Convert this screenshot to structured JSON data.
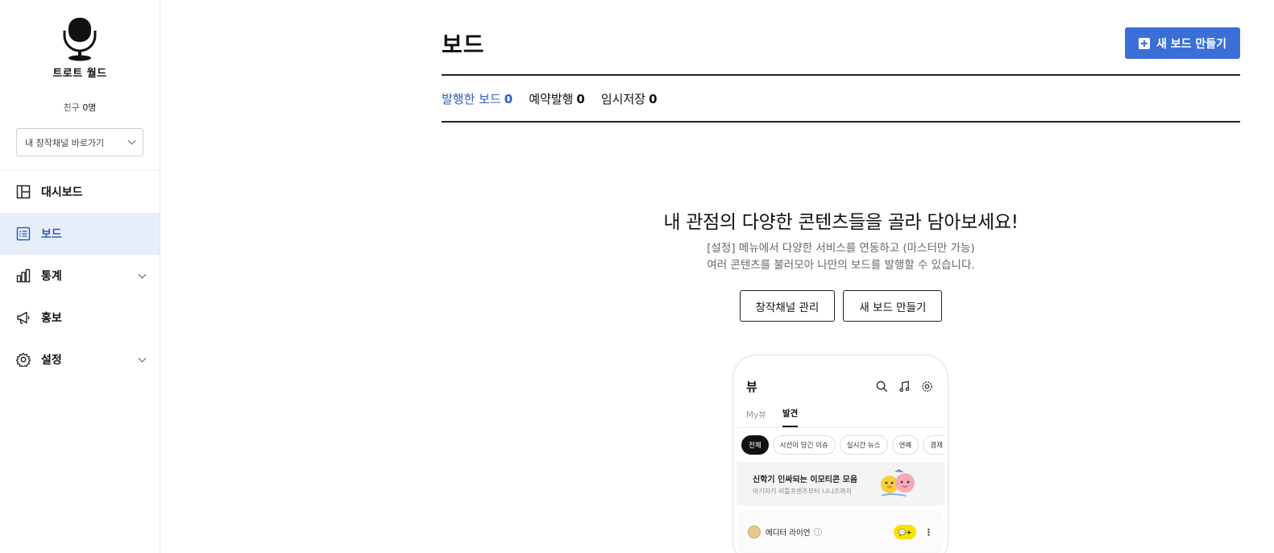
{
  "sidebar": {
    "channel_name": "트로트 월드",
    "friends_label": "친구",
    "friends_count": "0명",
    "channel_select": "내 창작채널 바로가기",
    "nav": [
      {
        "label": "대시보드",
        "icon": "dashboard-icon",
        "expandable": false,
        "active": false
      },
      {
        "label": "보드",
        "icon": "board-list-icon",
        "expandable": false,
        "active": true
      },
      {
        "label": "통계",
        "icon": "stats-chart-icon",
        "expandable": true,
        "active": false
      },
      {
        "label": "홍보",
        "icon": "megaphone-icon",
        "expandable": false,
        "active": false
      },
      {
        "label": "설정",
        "icon": "gear-icon",
        "expandable": true,
        "active": false
      }
    ]
  },
  "header": {
    "title": "보드",
    "new_board_button": "새 보드 만들기"
  },
  "tabs": [
    {
      "label": "발행한 보드",
      "count": "0",
      "active": true
    },
    {
      "label": "예약발행",
      "count": "0",
      "active": false
    },
    {
      "label": "임시저장",
      "count": "0",
      "active": false
    }
  ],
  "empty_state": {
    "title": "내 관점의 다양한 콘텐츠들을 골라 담아보세요!",
    "desc_line1": "[설정] 메뉴에서 다양한 서비스를 연동하고 (마스터만 가능)",
    "desc_line2": "여러 콘텐츠를 불러모아 나만의 보드를 발행할 수 있습니다.",
    "btn_manage": "창작채널 관리",
    "btn_new_board": "새 보드 만들기"
  },
  "phone": {
    "title": "뷰",
    "tabs": [
      "My뷰",
      "발견"
    ],
    "chips": [
      "전체",
      "시선이 당긴 이슈",
      "실시간 뉴스",
      "연예",
      "경제"
    ],
    "banner_title": "신학기 인싸되는 이모티콘 모음",
    "banner_sub": "아기자기 리틀프렌즈부터 니니즈까지",
    "card_name": "에디터 라이언",
    "info_mark": "i",
    "talk_badge": "💬+",
    "more": "⋮"
  },
  "colors": {
    "accent": "#3a6fd8",
    "active_bg": "#e8eef9",
    "active_text": "#2f5fb8"
  }
}
